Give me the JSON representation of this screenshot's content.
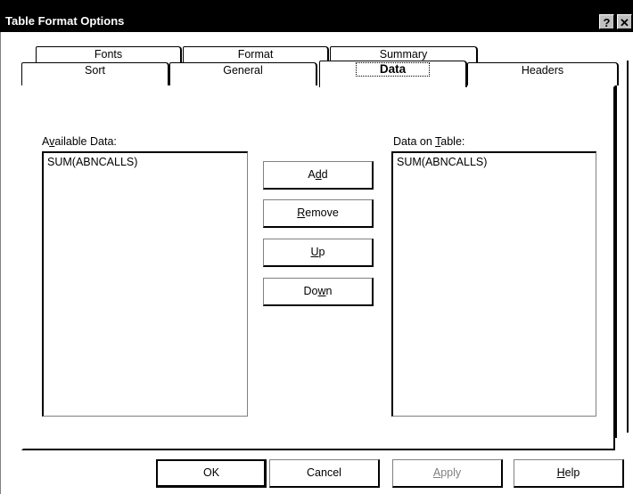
{
  "window": {
    "title": "Table Format Options",
    "help_glyph": "?",
    "close_glyph": "✕"
  },
  "tabs": {
    "row_back": [
      "Fonts",
      "Format",
      "Summary"
    ],
    "row_front": [
      "Sort",
      "General",
      "Data",
      "Headers"
    ],
    "selected": "Data"
  },
  "available": {
    "label_pre": "A",
    "label_u": "v",
    "label_post": "ailable Data:",
    "items": [
      "SUM(ABNCALLS)"
    ]
  },
  "on_table": {
    "label_pre": "Data on ",
    "label_u": "T",
    "label_post": "able:",
    "items": [
      "SUM(ABNCALLS)"
    ]
  },
  "buttons": {
    "add": {
      "pre": "A",
      "u": "d",
      "post": "d"
    },
    "remove": {
      "pre": "",
      "u": "R",
      "post": "emove"
    },
    "up": {
      "pre": "",
      "u": "U",
      "post": "p"
    },
    "down": {
      "pre": "Do",
      "u": "w",
      "post": "n"
    }
  },
  "footer": {
    "ok": "OK",
    "cancel": "Cancel",
    "apply": {
      "pre": "",
      "u": "A",
      "post": "pply"
    },
    "help": {
      "pre": "",
      "u": "H",
      "post": "elp"
    }
  },
  "colors": {
    "titlebar": "#000000",
    "face": "#ffffff",
    "disabled_text": "#808080"
  }
}
